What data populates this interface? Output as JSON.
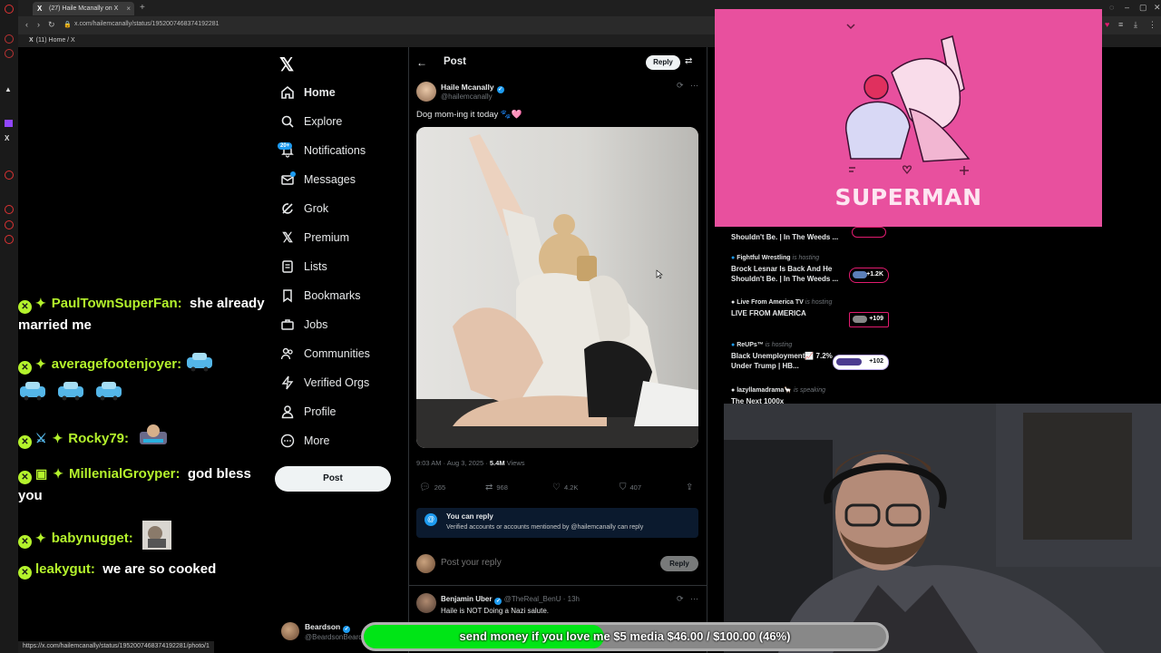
{
  "browser": {
    "tab_title": "(27) Haile Mcanally on X",
    "url": "x.com/hailemcanally/status/1952007468374192281",
    "bookmark": "(11) Home / X",
    "status_url": "https://x.com/hailemcanally/status/1952007468374192281/photo/1"
  },
  "nav": {
    "home": "Home",
    "explore": "Explore",
    "notifications": "Notifications",
    "notifications_badge": "20+",
    "messages": "Messages",
    "grok": "Grok",
    "premium": "Premium",
    "lists": "Lists",
    "bookmarks": "Bookmarks",
    "jobs": "Jobs",
    "communities": "Communities",
    "verified_orgs": "Verified Orgs",
    "profile": "Profile",
    "more": "More",
    "post_button": "Post"
  },
  "account": {
    "name": "Beardson",
    "handle": "@BeardsonBeard"
  },
  "post": {
    "heading": "Post",
    "reply_top": "Reply",
    "author_name": "Haile Mcanally",
    "author_handle": "@hailemcanally",
    "text": "Dog mom-ing it today 🐾🩷",
    "time": "9:03 AM · Aug 3, 2025 · ",
    "views_count": "5.4M",
    "views_label": " Views",
    "replies": "265",
    "reposts": "968",
    "likes": "4.2K",
    "bookmarks": "407"
  },
  "reply_notice": {
    "title": "You can reply",
    "body": "Verified accounts or accounts mentioned by @hailemcanally can reply"
  },
  "reply_box": {
    "placeholder": "Post your reply",
    "button": "Reply"
  },
  "first_reply": {
    "name": "Benjamin Uber",
    "meta": "@TheReal_BenU · 13h",
    "text": "Haile is NOT Doing a Nazi salute."
  },
  "spaces": [
    {
      "host": "",
      "hosting": "",
      "title": "Shouldn't Be. | In The Weeds ...",
      "listeners": ""
    },
    {
      "host": "Fightful Wrestling",
      "hosting": "is hosting",
      "title": "Brock Lesnar Is Back And He Shouldn't Be. | In The Weeds ...",
      "listeners": "+1.2K"
    },
    {
      "host": "Live From America TV",
      "hosting": "is hosting",
      "title": "LIVE FROM AMERICA",
      "listeners": "+109"
    },
    {
      "host": "ReUPs™",
      "hosting": "is hosting",
      "title": "Black Unemployment📈 7.2% Under Trump | HB...",
      "listeners": "+102"
    },
    {
      "host": "lazyllamadrama🦙",
      "hosting": "is speaking",
      "title": "The Next 1000x",
      "listeners": ""
    }
  ],
  "overlay": {
    "title": "SUPERMAN"
  },
  "chat": [
    {
      "user": "PaulTownSuperFan:",
      "text": "she already married me"
    },
    {
      "user": "averagefootenjoyer:",
      "text": ""
    },
    {
      "user": "Rocky79:",
      "text": ""
    },
    {
      "user": "MillenialGroyper:",
      "text": "god bless you"
    },
    {
      "user": "babynugget:",
      "text": ""
    },
    {
      "user": "leakygut:",
      "text": "we are so cooked"
    }
  ],
  "donation": {
    "text": "send money if you love me $5 media $46.00 / $100.00 (46%)",
    "progress": 0.46,
    "fill_color": "#00e516"
  },
  "colors": {
    "accent": "#1d9bf0",
    "chat_user": "#b4f22c",
    "overlay_bg": "#e8509e"
  }
}
